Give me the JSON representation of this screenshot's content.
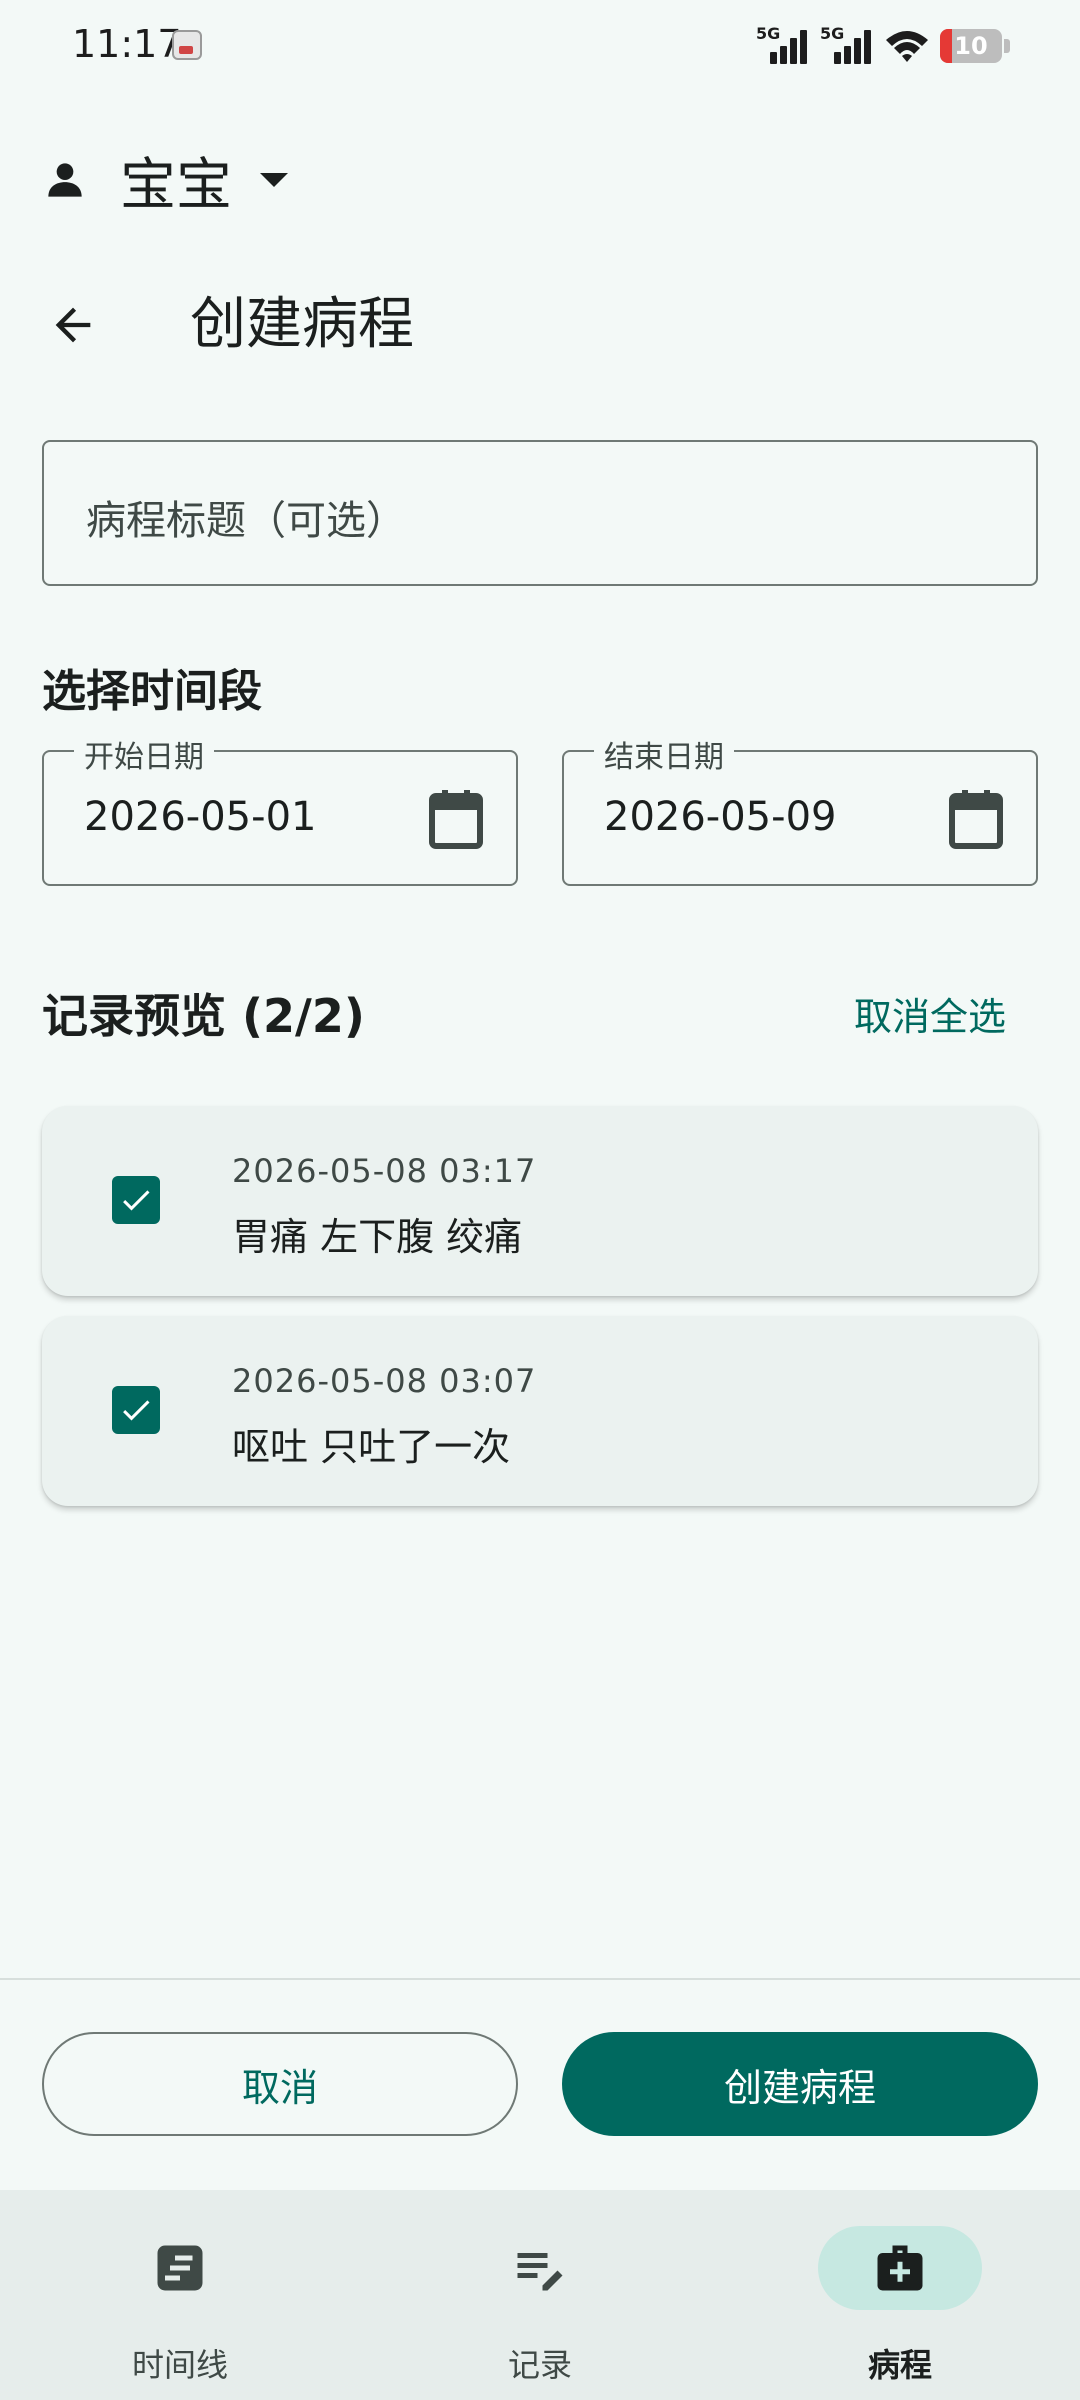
{
  "status_bar": {
    "time": "11:17",
    "signal_1_label": "5G",
    "signal_2_label": "5G",
    "battery_level": "10"
  },
  "profile": {
    "name": "宝宝"
  },
  "header": {
    "title": "创建病程"
  },
  "form": {
    "title_placeholder": "病程标题（可选）",
    "time_section_label": "选择时间段",
    "start_date_label": "开始日期",
    "start_date_value": "2026-05-01",
    "end_date_label": "结束日期",
    "end_date_value": "2026-05-09"
  },
  "records": {
    "section_label": "记录预览 (2/2)",
    "deselect_all_label": "取消全选",
    "items": [
      {
        "time": "2026-05-08 03:17",
        "description": "胃痛 左下腹 绞痛",
        "checked": true
      },
      {
        "time": "2026-05-08 03:07",
        "description": "呕吐 只吐了一次",
        "checked": true
      }
    ]
  },
  "actions": {
    "cancel_label": "取消",
    "create_label": "创建病程"
  },
  "bottom_nav": {
    "items": [
      {
        "label": "时间线",
        "icon": "timeline-icon",
        "active": false
      },
      {
        "label": "记录",
        "icon": "edit-notes-icon",
        "active": false
      },
      {
        "label": "病程",
        "icon": "medical-case-icon",
        "active": true
      }
    ]
  },
  "colors": {
    "primary": "#00695f",
    "background": "#f3f9f7",
    "card": "#ebf2f0",
    "nav_active_pill": "#c6e8e1"
  }
}
